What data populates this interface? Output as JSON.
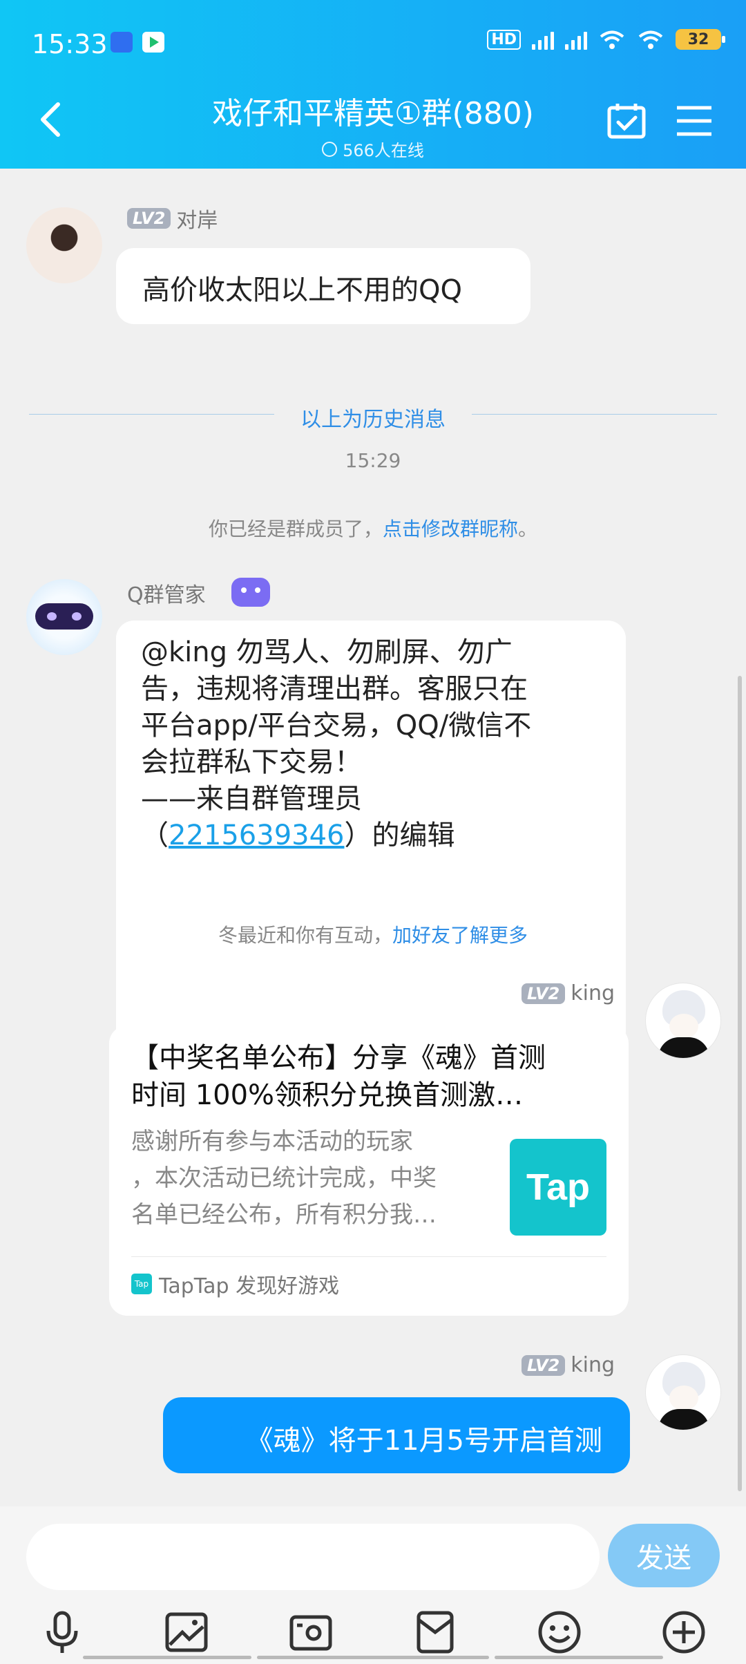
{
  "status_bar": {
    "time": "15:33",
    "battery": "32"
  },
  "header": {
    "title": "戏仔和平精英①群(880)",
    "online": "566人在线"
  },
  "messages": {
    "m1": {
      "level": "LV2",
      "nick": "对岸",
      "text": "高价收太阳以上不用的QQ"
    },
    "history_divider": "以上为历史消息",
    "timestamp": "15:29",
    "notice_member": {
      "prefix": "你已经是群成员了，",
      "link": "点击修改群昵称",
      "suffix": "。"
    },
    "m2": {
      "nick": "Q群管家",
      "lines": [
        "@king 勿骂人、勿刷屏、勿广",
        "告，违规将清理出群。客服只在",
        "平台app/平台交易，QQ/微信不",
        "会拉群私下交易！",
        "——来自群管理员"
      ],
      "last_prefix": "（",
      "last_link": "2215639346",
      "last_suffix": "）的编辑"
    },
    "notice_friend": {
      "prefix": "冬最近和你有互动，",
      "link": "加好友了解更多"
    },
    "m3": {
      "level": "LV2",
      "nick": "king",
      "card_title_1": "【中奖名单公布】分享《魂》首测",
      "card_title_2": "时间 100%领积分兑换首测激…",
      "card_desc_1": "感谢所有参与本活动的玩家",
      "card_desc_2": "，本次活动已统计完成，中奖",
      "card_desc_3": "名单已经公布，所有积分我…",
      "card_logo": "Tap",
      "card_source": "TapTap 发现好游戏"
    },
    "m4": {
      "level": "LV2",
      "nick": "king",
      "text": "《魂》将于11月5号开启首测"
    }
  },
  "input": {
    "send_label": "发送"
  },
  "colors": {
    "header_start": "#10c6f5",
    "header_end": "#1a9ff6",
    "self_bubble": "#0b99ff",
    "link": "#2f8ee6"
  }
}
